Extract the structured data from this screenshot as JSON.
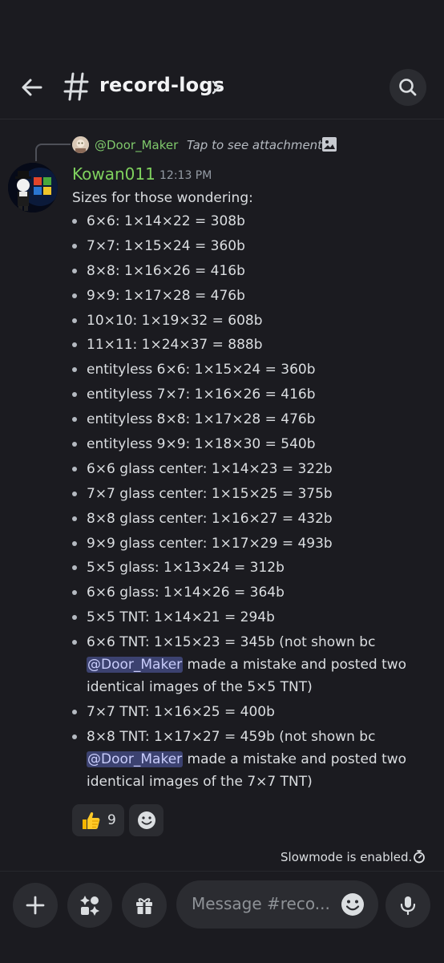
{
  "header": {
    "channel_name": "record-logs"
  },
  "reply": {
    "username": "@Door_Maker",
    "text": "Tap to see attachment"
  },
  "message": {
    "author": "Kowan011",
    "time": "12:13 PM",
    "intro": "Sizes for those wondering:",
    "items": [
      {
        "text": "6×6: 1×14×22 = 308b"
      },
      {
        "text": "7×7: 1×15×24 = 360b"
      },
      {
        "text": "8×8: 1×16×26 = 416b"
      },
      {
        "text": "9×9: 1×17×28 = 476b"
      },
      {
        "text": "10×10: 1×19×32 = 608b"
      },
      {
        "text": "11×11: 1×24×37 = 888b"
      },
      {
        "text": "entityless 6×6: 1×15×24 = 360b"
      },
      {
        "text": "entityless 7×7: 1×16×26 = 416b"
      },
      {
        "text": "entityless 8×8: 1×17×28 = 476b"
      },
      {
        "text": "entityless 9×9: 1×18×30 = 540b"
      },
      {
        "text": "6×6 glass center: 1×14×23 = 322b"
      },
      {
        "text": "7×7 glass center: 1×15×25 = 375b"
      },
      {
        "text": "8×8 glass center: 1×16×27 = 432b"
      },
      {
        "text": "9×9 glass center: 1×17×29 = 493b"
      },
      {
        "text": "5×5 glass: 1×13×24 = 312b"
      },
      {
        "text": "6×6 glass: 1×14×26 = 364b"
      },
      {
        "text": "5×5 TNT: 1×14×21 = 294b"
      },
      {
        "text": "6×6 TNT: 1×15×23 = 345b (not shown bc ",
        "mention": "@Door_Maker",
        "after": " made a mistake and posted two identical images of the 5×5 TNT)"
      },
      {
        "text": "7×7 TNT: 1×16×25 = 400b"
      },
      {
        "text": "8×8 TNT: 1×17×27 = 459b (not shown bc ",
        "mention": "@Door_Maker",
        "after": " made a mistake and posted two identical images of the 7×7 TNT)"
      }
    ]
  },
  "reactions": [
    {
      "emoji_icon": "thumbs-up-icon",
      "count": "9"
    }
  ],
  "slowmode_text": "Slowmode is enabled.",
  "composer": {
    "placeholder": "Message #reco..."
  },
  "colors": {
    "background": "#1b1b20",
    "username_green": "#7fd15e",
    "mention_bg": "#3c4270",
    "surface": "#2b2c31"
  }
}
